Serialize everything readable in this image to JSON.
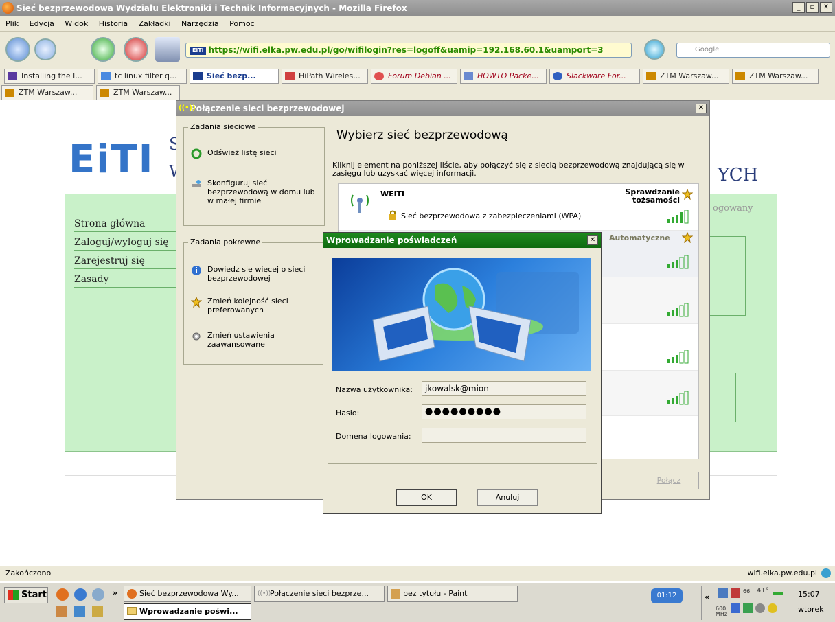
{
  "window": {
    "title": "Sieć bezprzewodowa Wydziału Elektroniki i Technik Informacyjnych - Mozilla Firefox"
  },
  "menu": [
    "Plik",
    "Edycja",
    "Widok",
    "Historia",
    "Zakładki",
    "Narzędzia",
    "Pomoc"
  ],
  "url": "https://wifi.elka.pw.edu.pl/go/wifilogin?res=logoff&uamip=192.168.60.1&uamport=3",
  "url_favicon": "EiTI",
  "search_placeholder": "Google",
  "tabs": [
    {
      "label": "Installing the l..."
    },
    {
      "label": "tc linux filter q..."
    },
    {
      "label": "Sieć bezp..."
    },
    {
      "label": "HiPath Wireles..."
    },
    {
      "label": "Forum Debian ..."
    },
    {
      "label": "HOWTO Packe..."
    },
    {
      "label": "Slackware For..."
    },
    {
      "label": "ZTM Warszaw..."
    },
    {
      "label": "ZTM Warszaw..."
    },
    {
      "label": "ZTM Warszaw..."
    },
    {
      "label": "ZTM Warszaw..."
    }
  ],
  "page": {
    "logo": "EiTI",
    "heading_fragment": "YCH",
    "side_letter_1": "S",
    "side_letter_2": "W",
    "nav": [
      "Strona główna",
      "Zaloguj/wyloguj się",
      "Zarejestruj się",
      "Zasady"
    ],
    "status_fragment": "ogowany"
  },
  "wireless_dialog": {
    "title": "Połączenie sieci bezprzewodowej",
    "network_tasks_header": "Zadania sieciowe",
    "refresh": "Odśwież listę sieci",
    "configure": "Skonfiguruj sieć bezprzewodową w domu lub w małej firmie",
    "related_header": "Zadania pokrewne",
    "learn": "Dowiedz się więcej o sieci bezprzewodowej",
    "order": "Zmień kolejność sieci preferowanych",
    "advanced": "Zmień ustawienia zaawansowane",
    "heading": "Wybierz sieć bezprzewodową",
    "description": "Kliknij element na poniższej liście, aby połączyć się z siecią bezprzewodową znajdującą się w zasięgu lub uzyskać więcej informacji.",
    "networks": [
      {
        "name": "WEiTI",
        "status": "Sprawdzanie tożsamości",
        "security": "Sieć bezprzewodowa z zabezpieczeniami (WPA)"
      },
      {
        "name": "",
        "status": "Automatyczne",
        "security": ""
      }
    ],
    "connect": "Połącz"
  },
  "credentials_dialog": {
    "title": "Wprowadzanie poświadczeń",
    "username_label": "Nazwa użytkownika:",
    "username": "jkowalsk@mion",
    "password_label": "Hasło:",
    "password": "●●●●●●●●●",
    "domain_label": "Domena logowania:",
    "domain": "",
    "ok": "OK",
    "cancel": "Anuluj"
  },
  "statusbar": {
    "left": "Zakończono",
    "right": "wifi.elka.pw.edu.pl"
  },
  "taskbar": {
    "start": "Start",
    "items": [
      "Sieć bezprzewodowa Wy...",
      "Połączenie sieci bezprze...",
      "bez tytułu - Paint",
      "Wprowadzanie poświ..."
    ],
    "tray_timer": "01:12",
    "cpu": "600 MHz",
    "temp": "41°",
    "cpu_load": "66",
    "time": "15:07",
    "day": "wtorek"
  },
  "colors": {
    "accent_green": "#0f6a0f",
    "page_green": "#c9f1c9",
    "logo_blue": "#3474c8"
  }
}
